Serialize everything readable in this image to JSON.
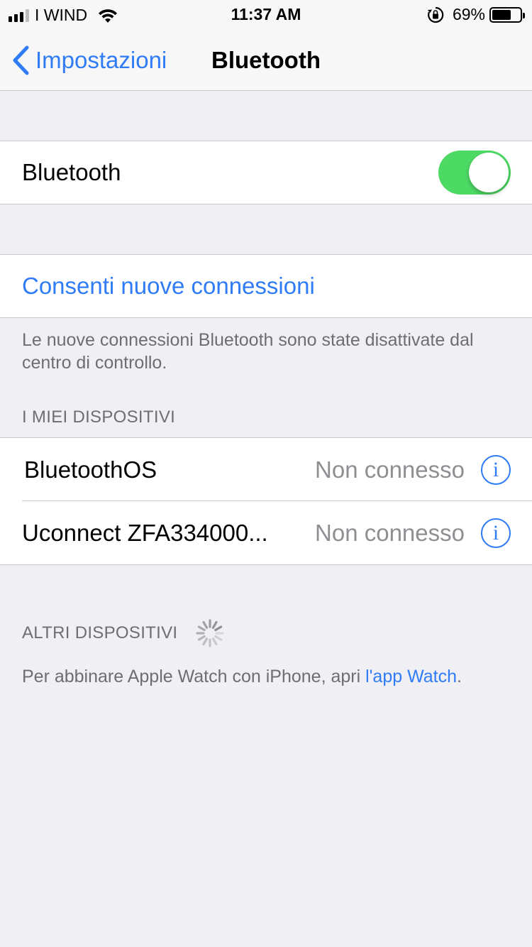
{
  "status_bar": {
    "carrier": "I WIND",
    "time": "11:37 AM",
    "battery_percent": "69%",
    "battery_level": 0.69,
    "icons": [
      "signal-icon",
      "wifi-icon",
      "rotation-lock-icon",
      "battery-icon"
    ]
  },
  "nav": {
    "back_label": "Impostazioni",
    "title": "Bluetooth"
  },
  "bluetooth_toggle": {
    "label": "Bluetooth",
    "on": true,
    "color": "#4cd964"
  },
  "allow_connections": {
    "label": "Consenti nuove connessioni",
    "footer": "Le nuove connessioni Bluetooth sono state disattivate dal centro di controllo."
  },
  "my_devices": {
    "header": "I MIEI DISPOSITIVI",
    "items": [
      {
        "name": "BluetoothOS",
        "status": "Non connesso"
      },
      {
        "name": "Uconnect ZFA334000...",
        "status": "Non connesso"
      }
    ]
  },
  "other_devices": {
    "header": "ALTRI DISPOSITIVI",
    "footer_prefix": "Per abbinare Apple Watch con iPhone, apri ",
    "footer_link": "l'app Watch",
    "footer_suffix": "."
  },
  "colors": {
    "accent": "#2f7cf6",
    "background": "#efeff4",
    "secondary_text": "#8e8e93"
  }
}
